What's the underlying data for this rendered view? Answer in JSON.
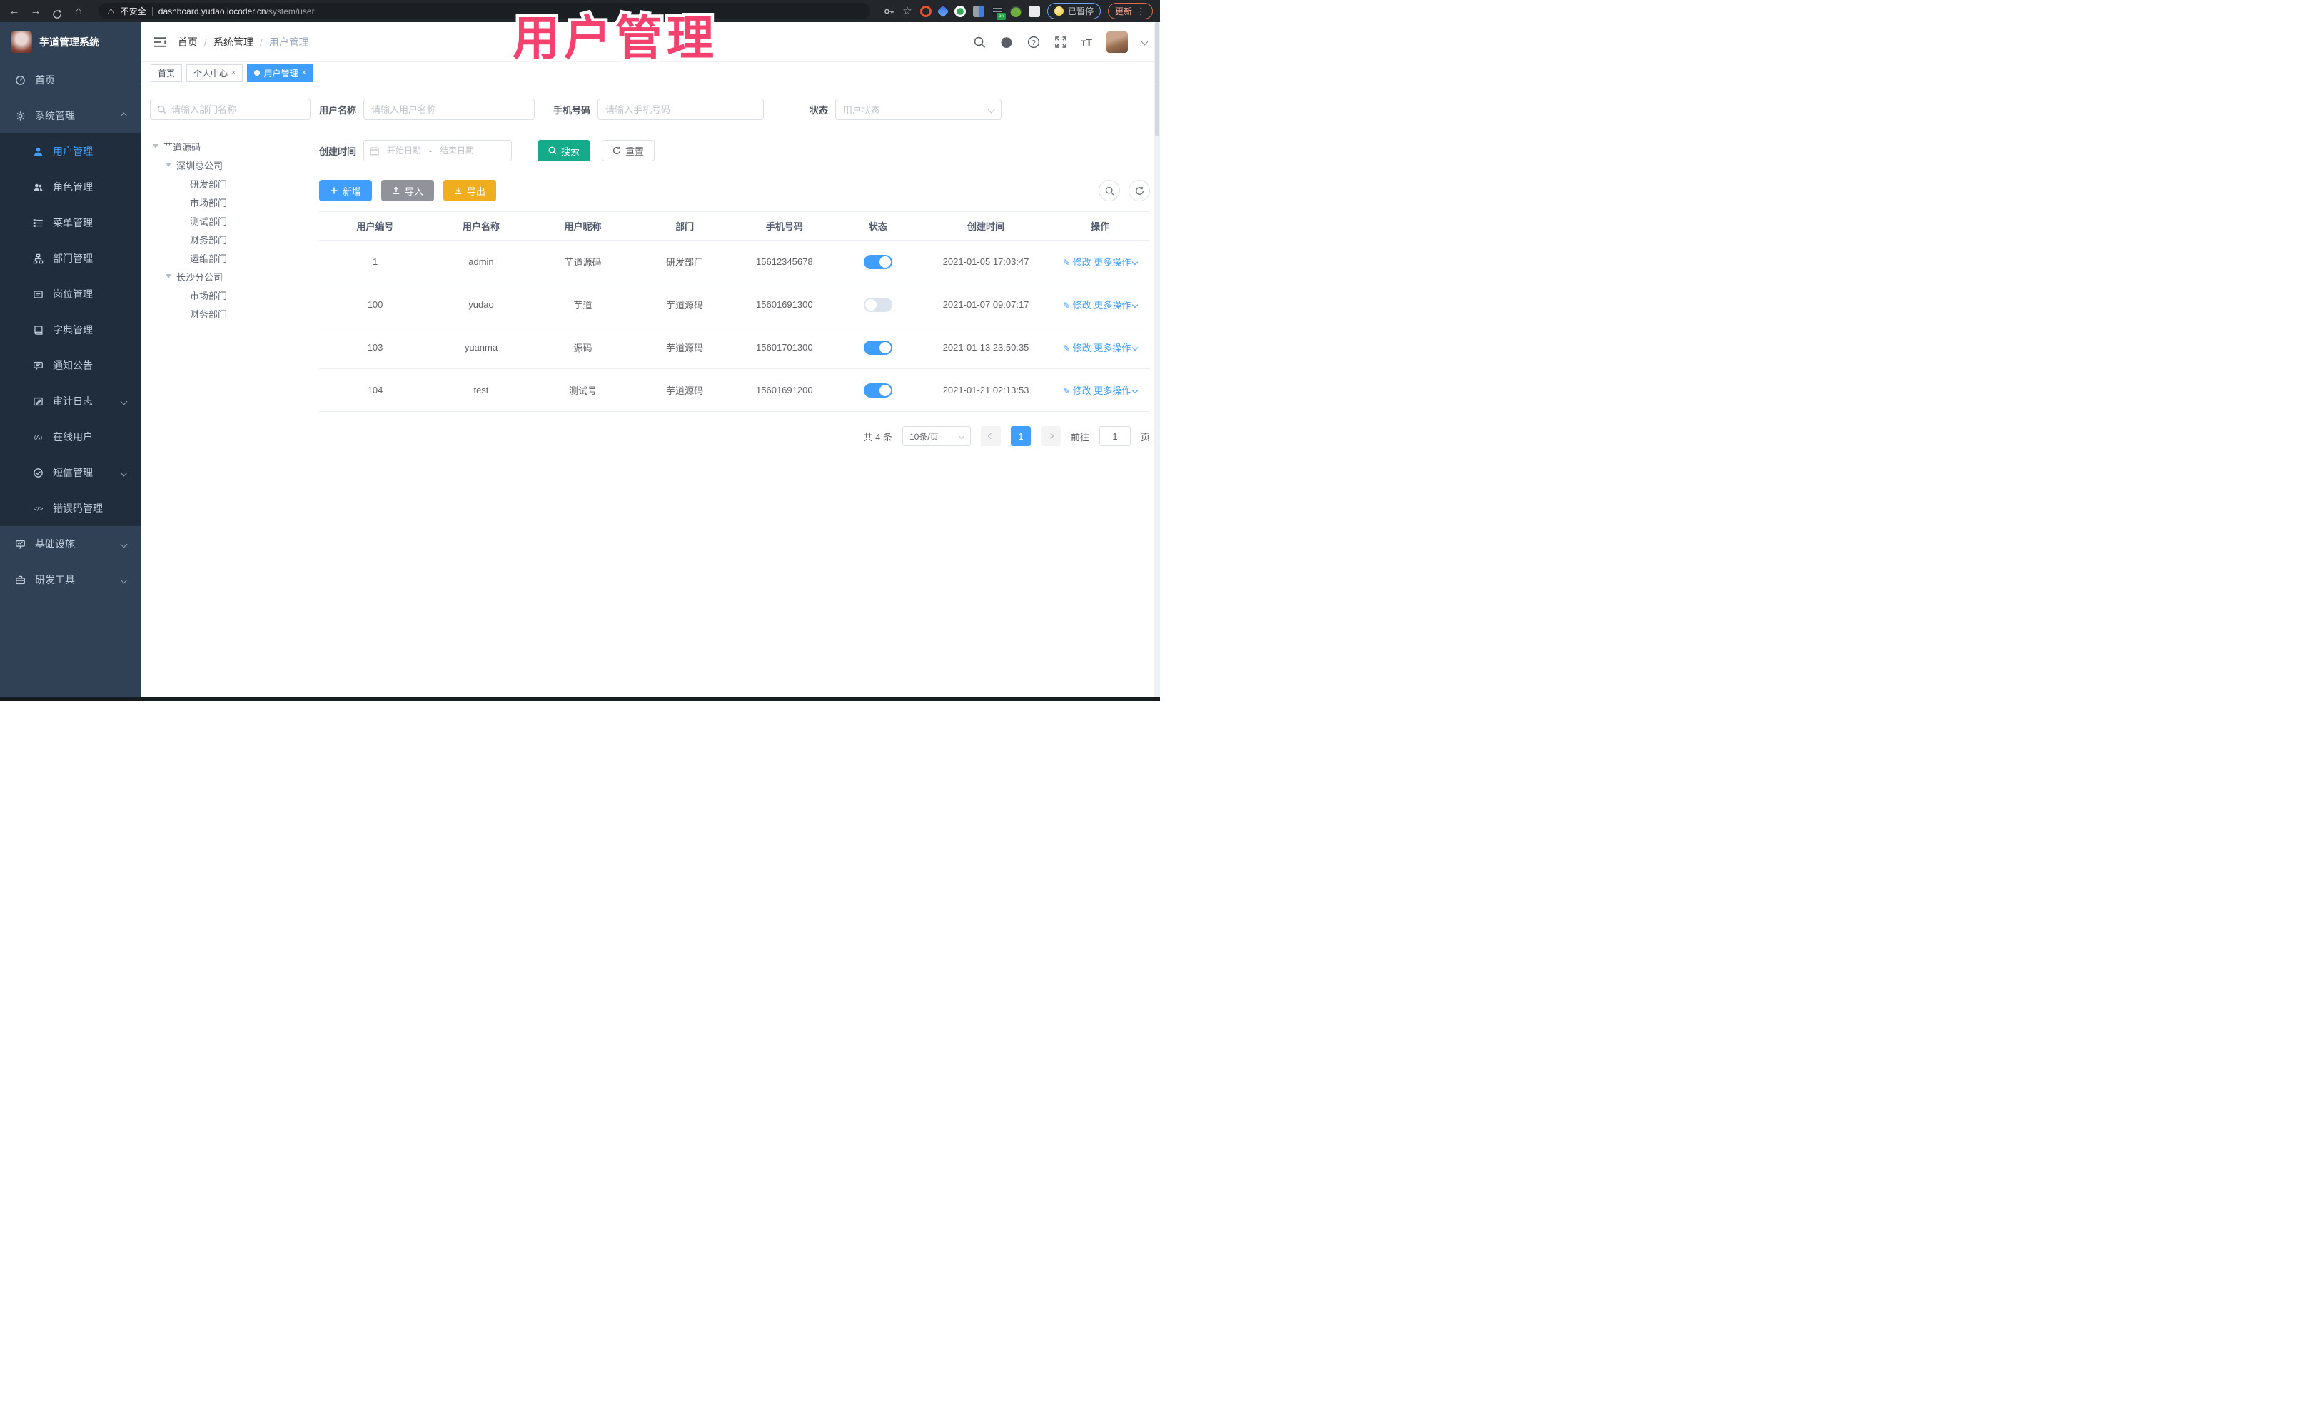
{
  "chrome": {
    "security": "不安全",
    "host": "dashboard.yudao.iocoder.cn",
    "path": "/system/user",
    "paused": "已暂停",
    "update": "更新"
  },
  "header": {
    "title": "芋道管理系统",
    "breadcrumb": [
      "首页",
      "系统管理",
      "用户管理"
    ],
    "separator": "/"
  },
  "tabs": [
    {
      "label": "首页"
    },
    {
      "label": "个人中心"
    },
    {
      "label": "用户管理"
    }
  ],
  "sidebar": {
    "items": [
      {
        "label": "首页"
      },
      {
        "label": "系统管理"
      },
      {
        "label": "用户管理"
      },
      {
        "label": "角色管理"
      },
      {
        "label": "菜单管理"
      },
      {
        "label": "部门管理"
      },
      {
        "label": "岗位管理"
      },
      {
        "label": "字典管理"
      },
      {
        "label": "通知公告"
      },
      {
        "label": "审计日志"
      },
      {
        "label": "在线用户"
      },
      {
        "label": "短信管理"
      },
      {
        "label": "错误码管理"
      },
      {
        "label": "基础设施"
      },
      {
        "label": "研发工具"
      }
    ]
  },
  "tree": {
    "search_placeholder": "请输入部门名称",
    "nodes": [
      {
        "label": "芋道源码"
      },
      {
        "label": "深圳总公司"
      },
      {
        "label": "研发部门"
      },
      {
        "label": "市场部门"
      },
      {
        "label": "测试部门"
      },
      {
        "label": "财务部门"
      },
      {
        "label": "运维部门"
      },
      {
        "label": "长沙分公司"
      },
      {
        "label": "市场部门"
      },
      {
        "label": "财务部门"
      }
    ]
  },
  "filters": {
    "username_label": "用户名称",
    "username_placeholder": "请输入用户名称",
    "mobile_label": "手机号码",
    "mobile_placeholder": "请输入手机号码",
    "status_label": "状态",
    "status_placeholder": "用户状态",
    "time_label": "创建时间",
    "start_placeholder": "开始日期",
    "range_separator": "-",
    "end_placeholder": "结束日期",
    "search": "搜索",
    "reset": "重置"
  },
  "toolbar": {
    "add": "新增",
    "import": "导入",
    "export": "导出"
  },
  "table": {
    "headers": [
      "用户编号",
      "用户名称",
      "用户昵称",
      "部门",
      "手机号码",
      "状态",
      "创建时间",
      "操作"
    ],
    "actions": {
      "edit": "修改",
      "more": "更多操作"
    },
    "rows": [
      {
        "id": "1",
        "username": "admin",
        "nickname": "芋道源码",
        "dept": "研发部门",
        "mobile": "15612345678",
        "status": "on",
        "created": "2021-01-05 17:03:47"
      },
      {
        "id": "100",
        "username": "yudao",
        "nickname": "芋道",
        "dept": "芋道源码",
        "mobile": "15601691300",
        "status": "off",
        "created": "2021-01-07 09:07:17"
      },
      {
        "id": "103",
        "username": "yuanma",
        "nickname": "源码",
        "dept": "芋道源码",
        "mobile": "15601701300",
        "status": "on",
        "created": "2021-01-13 23:50:35"
      },
      {
        "id": "104",
        "username": "test",
        "nickname": "测试号",
        "dept": "芋道源码",
        "mobile": "15601691200",
        "status": "on",
        "created": "2021-01-21 02:13:53"
      }
    ]
  },
  "pagination": {
    "total": "共 4 条",
    "size": "10条/页",
    "page": "1",
    "goto": "前往",
    "unit": "页"
  },
  "overlay": {
    "title": "用户管理"
  },
  "colors": {
    "accent": "#409EFF",
    "success": "#13ab89",
    "warning": "#f0ad1d",
    "sidebar": "#304156",
    "overlay_pink": "#f4416d"
  }
}
